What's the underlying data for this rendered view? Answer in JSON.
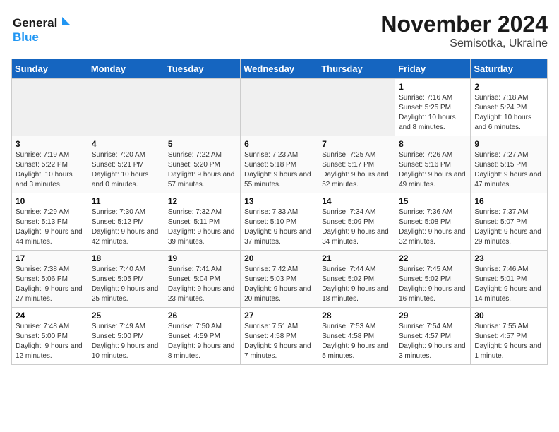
{
  "logo": {
    "line1": "General",
    "line2": "Blue"
  },
  "title": "November 2024",
  "subtitle": "Semisotka, Ukraine",
  "weekdays": [
    "Sunday",
    "Monday",
    "Tuesday",
    "Wednesday",
    "Thursday",
    "Friday",
    "Saturday"
  ],
  "weeks": [
    [
      {
        "day": "",
        "info": ""
      },
      {
        "day": "",
        "info": ""
      },
      {
        "day": "",
        "info": ""
      },
      {
        "day": "",
        "info": ""
      },
      {
        "day": "",
        "info": ""
      },
      {
        "day": "1",
        "info": "Sunrise: 7:16 AM\nSunset: 5:25 PM\nDaylight: 10 hours and 8 minutes."
      },
      {
        "day": "2",
        "info": "Sunrise: 7:18 AM\nSunset: 5:24 PM\nDaylight: 10 hours and 6 minutes."
      }
    ],
    [
      {
        "day": "3",
        "info": "Sunrise: 7:19 AM\nSunset: 5:22 PM\nDaylight: 10 hours and 3 minutes."
      },
      {
        "day": "4",
        "info": "Sunrise: 7:20 AM\nSunset: 5:21 PM\nDaylight: 10 hours and 0 minutes."
      },
      {
        "day": "5",
        "info": "Sunrise: 7:22 AM\nSunset: 5:20 PM\nDaylight: 9 hours and 57 minutes."
      },
      {
        "day": "6",
        "info": "Sunrise: 7:23 AM\nSunset: 5:18 PM\nDaylight: 9 hours and 55 minutes."
      },
      {
        "day": "7",
        "info": "Sunrise: 7:25 AM\nSunset: 5:17 PM\nDaylight: 9 hours and 52 minutes."
      },
      {
        "day": "8",
        "info": "Sunrise: 7:26 AM\nSunset: 5:16 PM\nDaylight: 9 hours and 49 minutes."
      },
      {
        "day": "9",
        "info": "Sunrise: 7:27 AM\nSunset: 5:15 PM\nDaylight: 9 hours and 47 minutes."
      }
    ],
    [
      {
        "day": "10",
        "info": "Sunrise: 7:29 AM\nSunset: 5:13 PM\nDaylight: 9 hours and 44 minutes."
      },
      {
        "day": "11",
        "info": "Sunrise: 7:30 AM\nSunset: 5:12 PM\nDaylight: 9 hours and 42 minutes."
      },
      {
        "day": "12",
        "info": "Sunrise: 7:32 AM\nSunset: 5:11 PM\nDaylight: 9 hours and 39 minutes."
      },
      {
        "day": "13",
        "info": "Sunrise: 7:33 AM\nSunset: 5:10 PM\nDaylight: 9 hours and 37 minutes."
      },
      {
        "day": "14",
        "info": "Sunrise: 7:34 AM\nSunset: 5:09 PM\nDaylight: 9 hours and 34 minutes."
      },
      {
        "day": "15",
        "info": "Sunrise: 7:36 AM\nSunset: 5:08 PM\nDaylight: 9 hours and 32 minutes."
      },
      {
        "day": "16",
        "info": "Sunrise: 7:37 AM\nSunset: 5:07 PM\nDaylight: 9 hours and 29 minutes."
      }
    ],
    [
      {
        "day": "17",
        "info": "Sunrise: 7:38 AM\nSunset: 5:06 PM\nDaylight: 9 hours and 27 minutes."
      },
      {
        "day": "18",
        "info": "Sunrise: 7:40 AM\nSunset: 5:05 PM\nDaylight: 9 hours and 25 minutes."
      },
      {
        "day": "19",
        "info": "Sunrise: 7:41 AM\nSunset: 5:04 PM\nDaylight: 9 hours and 23 minutes."
      },
      {
        "day": "20",
        "info": "Sunrise: 7:42 AM\nSunset: 5:03 PM\nDaylight: 9 hours and 20 minutes."
      },
      {
        "day": "21",
        "info": "Sunrise: 7:44 AM\nSunset: 5:02 PM\nDaylight: 9 hours and 18 minutes."
      },
      {
        "day": "22",
        "info": "Sunrise: 7:45 AM\nSunset: 5:02 PM\nDaylight: 9 hours and 16 minutes."
      },
      {
        "day": "23",
        "info": "Sunrise: 7:46 AM\nSunset: 5:01 PM\nDaylight: 9 hours and 14 minutes."
      }
    ],
    [
      {
        "day": "24",
        "info": "Sunrise: 7:48 AM\nSunset: 5:00 PM\nDaylight: 9 hours and 12 minutes."
      },
      {
        "day": "25",
        "info": "Sunrise: 7:49 AM\nSunset: 5:00 PM\nDaylight: 9 hours and 10 minutes."
      },
      {
        "day": "26",
        "info": "Sunrise: 7:50 AM\nSunset: 4:59 PM\nDaylight: 9 hours and 8 minutes."
      },
      {
        "day": "27",
        "info": "Sunrise: 7:51 AM\nSunset: 4:58 PM\nDaylight: 9 hours and 7 minutes."
      },
      {
        "day": "28",
        "info": "Sunrise: 7:53 AM\nSunset: 4:58 PM\nDaylight: 9 hours and 5 minutes."
      },
      {
        "day": "29",
        "info": "Sunrise: 7:54 AM\nSunset: 4:57 PM\nDaylight: 9 hours and 3 minutes."
      },
      {
        "day": "30",
        "info": "Sunrise: 7:55 AM\nSunset: 4:57 PM\nDaylight: 9 hours and 1 minute."
      }
    ]
  ]
}
